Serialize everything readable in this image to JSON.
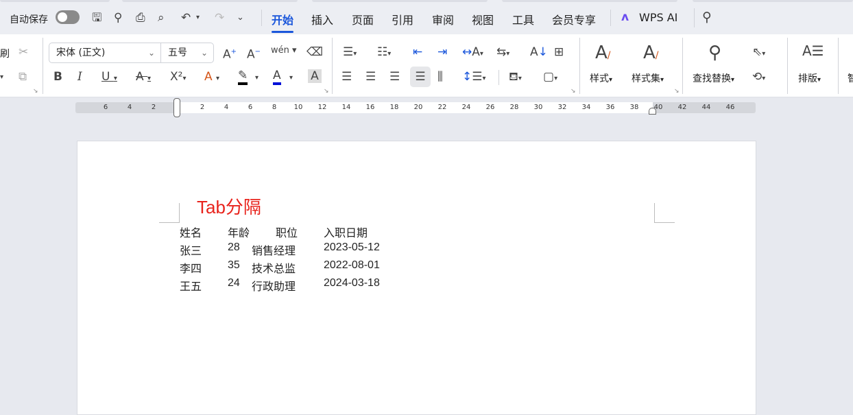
{
  "topbar": {
    "autosave_label": "自动保存",
    "autosave_on": false,
    "tabs": [
      {
        "label": "开始",
        "active": true
      },
      {
        "label": "插入"
      },
      {
        "label": "页面"
      },
      {
        "label": "引用"
      },
      {
        "label": "审阅"
      },
      {
        "label": "视图"
      },
      {
        "label": "工具"
      },
      {
        "label": "会员专享"
      }
    ],
    "wps_ai": "WPS AI",
    "accent": "#1a56db"
  },
  "ribbon": {
    "format_painter_label": "刷",
    "font_name": "宋体 (正文)",
    "font_size": "五号",
    "pinyin_label": "wén",
    "style_label": "样式",
    "style_set_label": "样式集",
    "find_replace_label": "查找替换",
    "layout_label": "排版",
    "cutoff_label": "智"
  },
  "ruler": {
    "left": [
      "6",
      "4",
      "2"
    ],
    "right": [
      "2",
      "4",
      "6",
      "8",
      "10",
      "12",
      "14",
      "16",
      "18",
      "20",
      "22",
      "24",
      "26",
      "28",
      "30",
      "32",
      "34",
      "36",
      "38",
      "40",
      "42",
      "44",
      "46"
    ]
  },
  "document": {
    "heading": "Tab分隔",
    "heading_color": "#e8231c",
    "headers": [
      "姓名",
      "年龄",
      "职位",
      "入职日期"
    ],
    "rows": [
      [
        "张三",
        "28",
        "销售经理",
        "2023-05-12"
      ],
      [
        "李四",
        "35",
        "技术总监",
        "2022-08-01"
      ],
      [
        "王五",
        "24",
        "行政助理",
        "2024-03-18"
      ]
    ]
  }
}
